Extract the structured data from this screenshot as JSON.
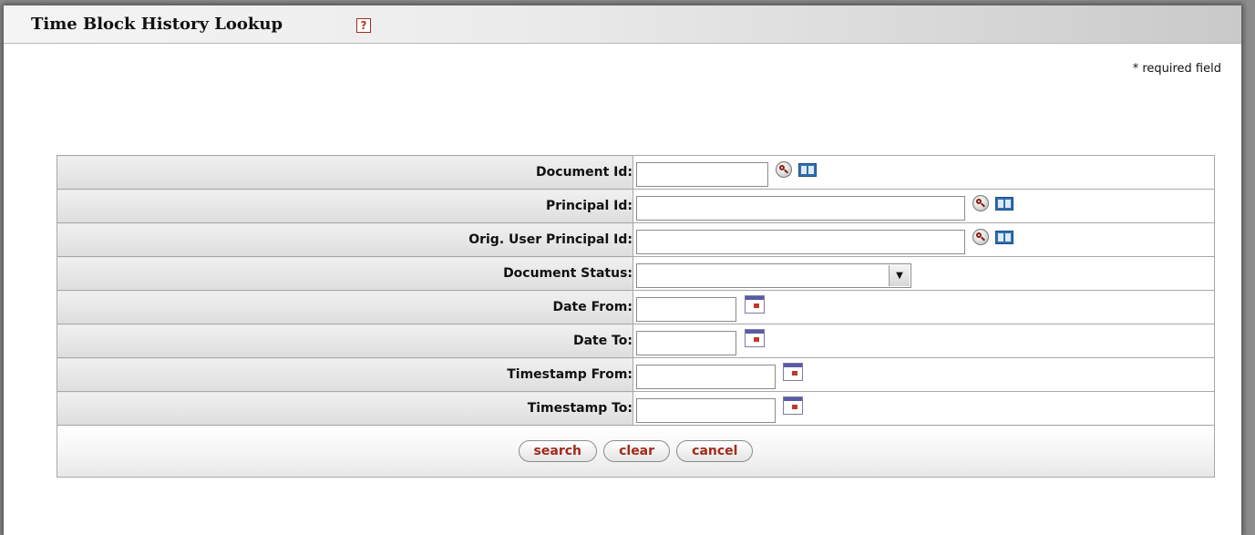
{
  "page": {
    "title": "Time Block History Lookup",
    "help_glyph": "?",
    "required_note": "* required field"
  },
  "form": {
    "fields": [
      {
        "label": "Document Id:",
        "type": "text",
        "value": "",
        "icons": [
          "search-icon",
          "book-icon"
        ]
      },
      {
        "label": "Principal Id:",
        "type": "text",
        "value": "",
        "icons": [
          "search-icon",
          "book-icon"
        ]
      },
      {
        "label": "Orig. User Principal Id:",
        "type": "text",
        "value": "",
        "icons": [
          "search-icon",
          "book-icon"
        ]
      },
      {
        "label": "Document Status:",
        "type": "select",
        "value": "",
        "icons": []
      },
      {
        "label": "Date From:",
        "type": "text",
        "value": "",
        "icons": [
          "calendar-icon"
        ]
      },
      {
        "label": "Date To:",
        "type": "text",
        "value": "",
        "icons": [
          "calendar-icon"
        ]
      },
      {
        "label": "Timestamp From:",
        "type": "text",
        "value": "",
        "icons": [
          "calendar-icon"
        ]
      },
      {
        "label": "Timestamp To:",
        "type": "text",
        "value": "",
        "icons": [
          "calendar-icon"
        ]
      }
    ],
    "buttons": {
      "search": "search",
      "clear": "clear",
      "cancel": "cancel"
    }
  },
  "colors": {
    "button_text": "#a12a1d",
    "help_icon": "#b03a2a",
    "book_icon": "#2f6fb3",
    "calendar_header": "#5a5aa8"
  }
}
